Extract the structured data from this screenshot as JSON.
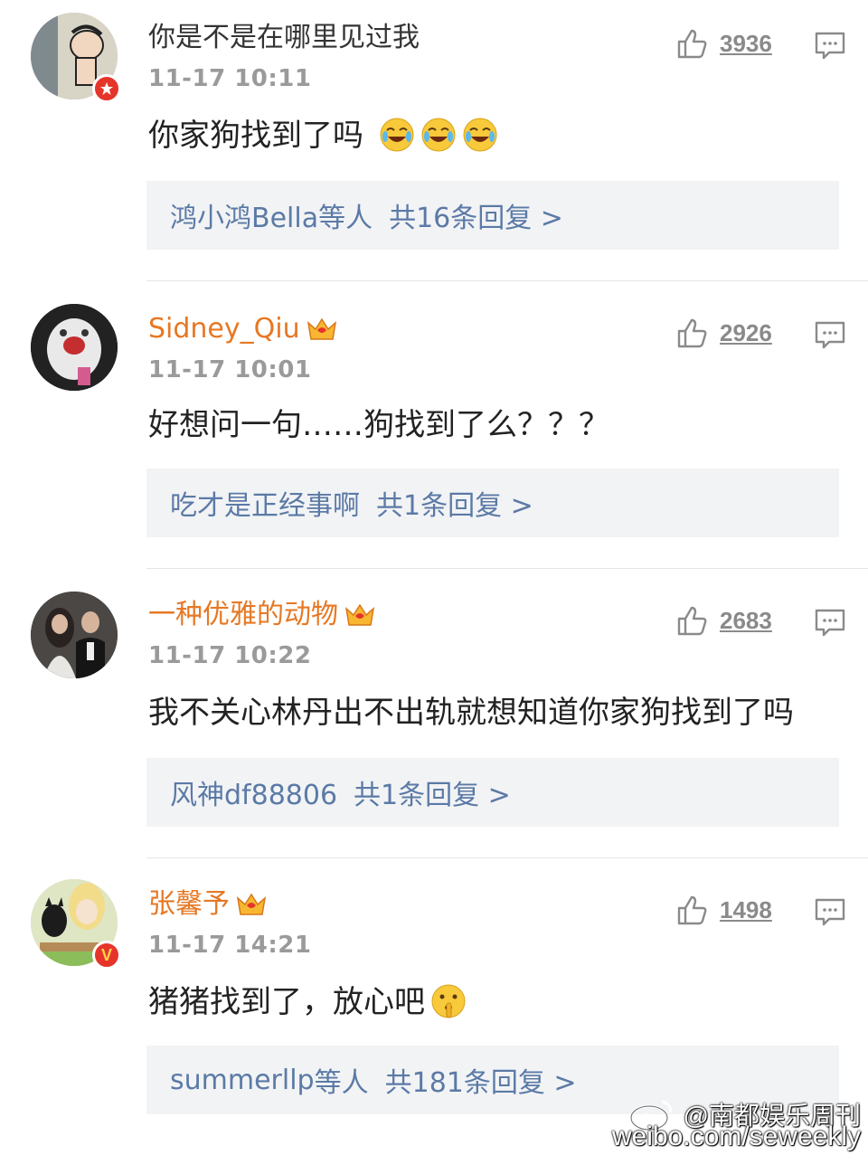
{
  "comments": [
    {
      "username": "你是不是在哪里见过我",
      "vip": false,
      "timestamp": "11-17 10:11",
      "content": "你家狗找到了吗",
      "emoji_count": 3,
      "likes": "3936",
      "replies_who": "鸿小鸿Bella",
      "replies_suffix": "等人",
      "replies_count": "共16条回复 >"
    },
    {
      "username": "Sidney_Qiu",
      "vip": true,
      "timestamp": "11-17 10:01",
      "content": "好想问一句……狗找到了么？？？",
      "likes": "2926",
      "replies_who": "吃才是正经事啊",
      "replies_suffix": "",
      "replies_count": "共1条回复 >"
    },
    {
      "username": "一种优雅的动物",
      "vip": true,
      "timestamp": "11-17 10:22",
      "content": "我不关心林丹出不出轨就想知道你家狗找到了吗",
      "likes": "2683",
      "replies_who": "风神df88806",
      "replies_suffix": "",
      "replies_count": "共1条回复 >"
    },
    {
      "username": "张馨予",
      "vip": true,
      "timestamp": "11-17 14:21",
      "content": "猪猪找到了，放心吧",
      "emoji_count": 1,
      "likes": "1498",
      "replies_who": "summerllp",
      "replies_suffix": "等人",
      "replies_count": "共181条回复 >"
    }
  ],
  "watermark": {
    "handle": "@南都娱乐周刊",
    "url": "weibo.com/seweekly"
  },
  "colors": {
    "vip_name": "#e67824",
    "reply_link": "#5b7aa6",
    "reply_bg": "#f2f3f5",
    "timestamp": "#9a9a9a"
  },
  "icons": [
    "thumbs-up-icon",
    "comment-bubble-icon",
    "vip-crown-icon",
    "verified-badge-icon",
    "laughing-crying-emoji",
    "shushing-emoji",
    "weibo-logo-icon"
  ]
}
